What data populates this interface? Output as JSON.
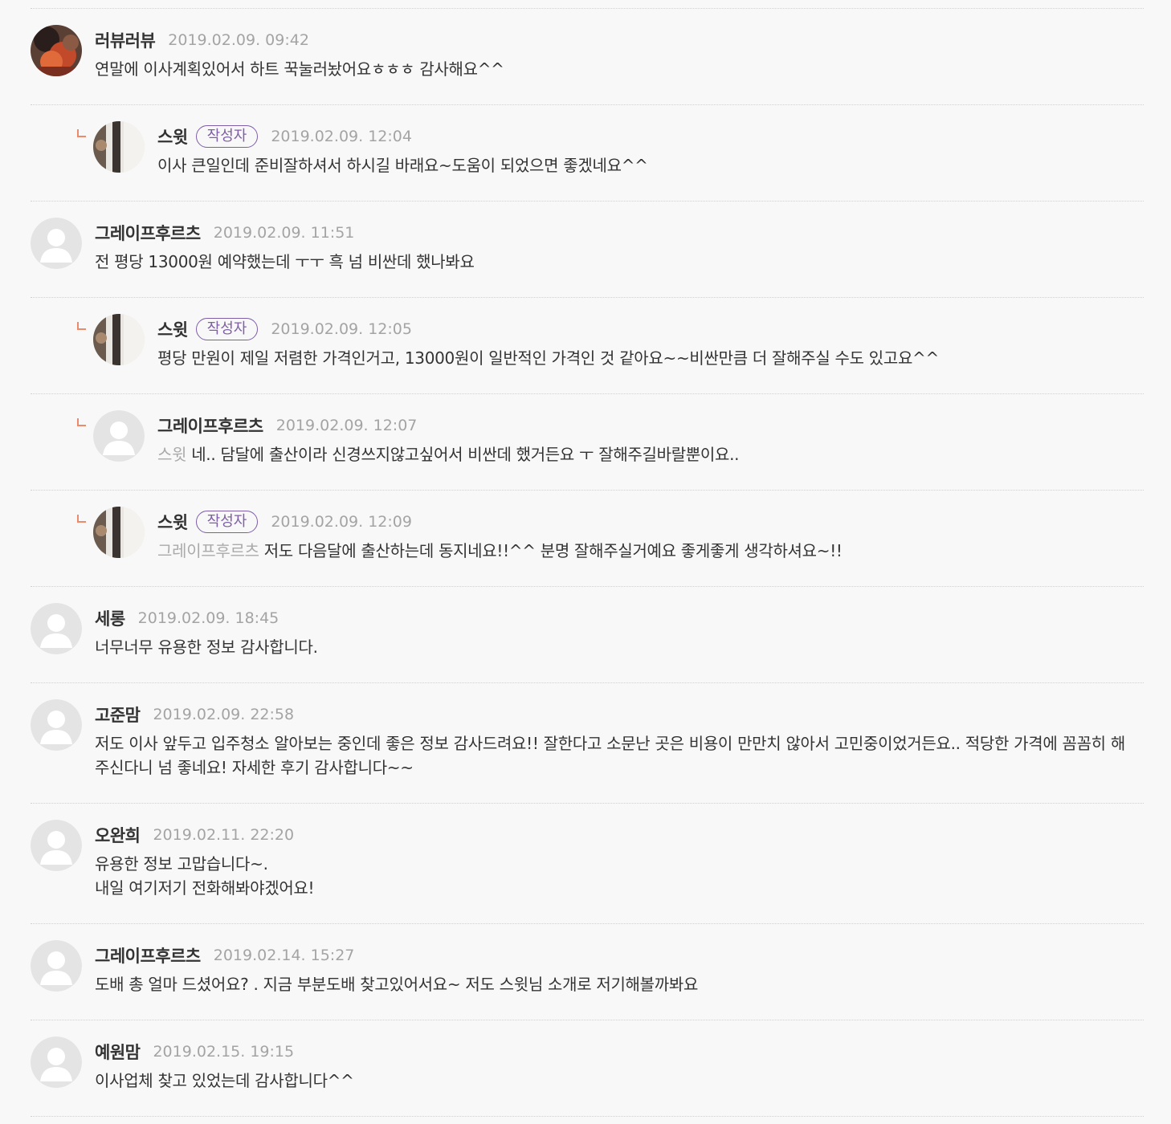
{
  "colors": {
    "background": "#f8f8f8",
    "author_badge": "#7e5ea6",
    "reply_marker": "#ec8b6c",
    "date": "#a4a4a4",
    "mention": "#aaaaaa"
  },
  "comments": [
    {
      "author": "러뷰러뷰",
      "date": "2019.02.09. 09:42",
      "text": "연말에 이사계획있어서 하트 꾹눌러놨어요ㅎㅎㅎ 감사해요^^",
      "avatar": "photo-avatar"
    },
    {
      "author": "스윗",
      "badge": "작성자",
      "date": "2019.02.09. 12:04",
      "text": "이사 큰일인데 준비잘하셔서 하시길 바래요~도움이 되었으면 좋겠네요^^",
      "avatar": "author-photo-avatar"
    },
    {
      "author": "그레이프후르츠",
      "date": "2019.02.09. 11:51",
      "text": "전 평당 13000원 예약했는데 ㅜㅜ 흑 넘 비싼데 했나봐요",
      "avatar": "default-user-icon"
    },
    {
      "author": "스윗",
      "badge": "작성자",
      "date": "2019.02.09. 12:05",
      "text": "평당 만원이 제일 저렴한 가격인거고, 13000원이 일반적인 가격인 것 같아요~~비싼만큼 더 잘해주실 수도 있고요^^",
      "avatar": "author-photo-avatar"
    },
    {
      "author": "그레이프후르츠",
      "date": "2019.02.09. 12:07",
      "mention": "스윗",
      "text": "네.. 담달에 출산이라 신경쓰지않고싶어서 비싼데 했거든요 ㅜ 잘해주길바랄뿐이요..",
      "avatar": "default-user-icon"
    },
    {
      "author": "스윗",
      "badge": "작성자",
      "date": "2019.02.09. 12:09",
      "mention": "그레이프후르츠",
      "text": "저도 다음달에 출산하는데 동지네요!!^^ 분명 잘해주실거예요 좋게좋게 생각하셔요~!!",
      "avatar": "author-photo-avatar"
    },
    {
      "author": "세롱",
      "date": "2019.02.09. 18:45",
      "text": "너무너무 유용한 정보 감사합니다.",
      "avatar": "default-user-icon"
    },
    {
      "author": "고준맘",
      "date": "2019.02.09. 22:58",
      "text": "저도 이사 앞두고 입주청소 알아보는 중인데 좋은 정보 감사드려요!! 잘한다고 소문난 곳은 비용이 만만치 않아서 고민중이었거든요.. 적당한 가격에 꼼꼼히 해주신다니 넘 좋네요! 자세한 후기 감사합니다~~",
      "avatar": "default-user-icon"
    },
    {
      "author": "오완희",
      "date": "2019.02.11. 22:20",
      "lines": [
        "유용한 정보 고맙습니다~.",
        "내일 여기저기 전화해봐야겠어요!"
      ],
      "avatar": "default-user-icon"
    },
    {
      "author": "그레이프후르츠",
      "date": "2019.02.14. 15:27",
      "text": "도배 총 얼마 드셨어요? . 지금 부분도배 찾고있어서요~ 저도 스윗님 소개로 저기해볼까봐요",
      "avatar": "default-user-icon"
    },
    {
      "author": "예원맘",
      "date": "2019.02.15. 19:15",
      "text": "이사업체 찾고 있었는데 감사합니다^^",
      "avatar": "default-user-icon"
    }
  ]
}
